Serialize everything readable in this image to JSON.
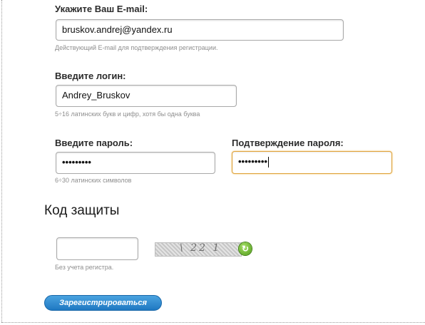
{
  "email": {
    "label": "Укажите Ваш E-mail:",
    "value": "bruskov.andrej@yandex.ru",
    "hint": "Действующий E-mail для подтверждения регистрации."
  },
  "login": {
    "label": "Введите логин:",
    "value": "Andrey_Bruskov",
    "hint": "5÷16 латинских букв и цифр, хотя бы одна буква"
  },
  "password": {
    "label": "Введите пароль:",
    "value": "•••••••••",
    "hint": "6÷30 латинских символов"
  },
  "password_confirm": {
    "label": "Подтверждение пароля:",
    "value": "•••••••••"
  },
  "captcha": {
    "title": "Код защиты",
    "value": "",
    "hint": "Без учета регистра.",
    "image_text": "\\ 22 1",
    "refresh_icon": "refresh-icon"
  },
  "submit": {
    "label": "Зарегистрироваться"
  },
  "colors": {
    "focus_border": "#e0a33a",
    "button_top": "#4aa3e0",
    "button_bottom": "#1f78c2",
    "refresh_green": "#4e9a16"
  }
}
